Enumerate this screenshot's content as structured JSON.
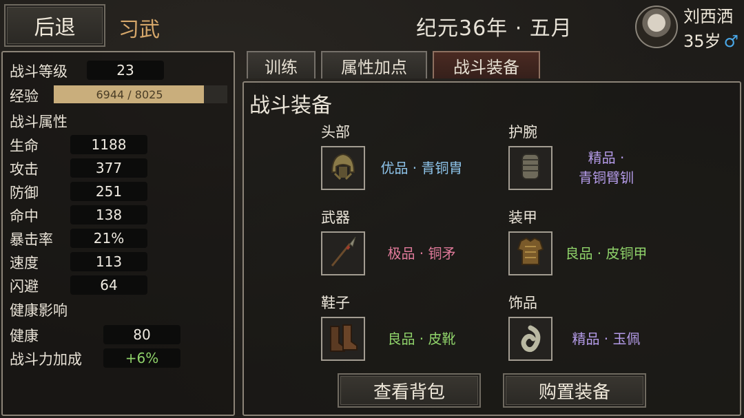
{
  "header": {
    "back_label": "后退",
    "page_title": "习武",
    "date": "纪元36年 · 五月",
    "character": {
      "name": "刘西洒",
      "age": "35岁",
      "gender_symbol": "♂"
    }
  },
  "left_panel": {
    "level": {
      "label": "战斗等级",
      "value": "23"
    },
    "exp": {
      "label": "经验",
      "current": 6944,
      "max": 8025,
      "text": "6944 / 8025"
    },
    "combat_header": "战斗属性",
    "combat_stats": [
      {
        "label": "生命",
        "value": "1188"
      },
      {
        "label": "攻击",
        "value": "377"
      },
      {
        "label": "防御",
        "value": "251"
      },
      {
        "label": "命中",
        "value": "138"
      },
      {
        "label": "暴击率",
        "value": "21%"
      },
      {
        "label": "速度",
        "value": "113"
      },
      {
        "label": "闪避",
        "value": "64"
      }
    ],
    "health_header": "健康影响",
    "health_stats": [
      {
        "label": "健康",
        "value": "80"
      },
      {
        "label": "战斗力加成",
        "value": "+6%"
      }
    ]
  },
  "tabs": [
    {
      "label": "训练",
      "active": false
    },
    {
      "label": "属性加点",
      "active": false
    },
    {
      "label": "战斗装备",
      "active": true
    }
  ],
  "equipment": {
    "title": "战斗装备",
    "slots": [
      {
        "slot": "头部",
        "item_lines": [
          "优品 · 青铜胄"
        ],
        "quality": "blue",
        "icon": "bronze-helmet-icon"
      },
      {
        "slot": "护腕",
        "item_lines": [
          "精品 ·",
          "青铜臂钏"
        ],
        "quality": "purple",
        "icon": "bronze-bracer-icon"
      },
      {
        "slot": "武器",
        "item_lines": [
          "极品 · 铜矛"
        ],
        "quality": "pink",
        "icon": "bronze-spear-icon"
      },
      {
        "slot": "装甲",
        "item_lines": [
          "良品 · 皮铜甲"
        ],
        "quality": "green",
        "icon": "leather-bronze-armor-icon"
      },
      {
        "slot": "鞋子",
        "item_lines": [
          "良品 · 皮靴"
        ],
        "quality": "green",
        "icon": "leather-boots-icon"
      },
      {
        "slot": "饰品",
        "item_lines": [
          "精品 · 玉佩"
        ],
        "quality": "purple",
        "icon": "jade-pendant-icon"
      }
    ],
    "buttons": {
      "view_bag": "查看背包",
      "buy_equipment": "购置装备"
    }
  },
  "colors": {
    "quality_blue": "#8ec4ea",
    "quality_purple": "#b49be8",
    "quality_pink": "#e07a9a",
    "quality_green": "#8fd26a",
    "title_accent": "#d6a76a",
    "male_symbol": "#4aa8e8"
  }
}
